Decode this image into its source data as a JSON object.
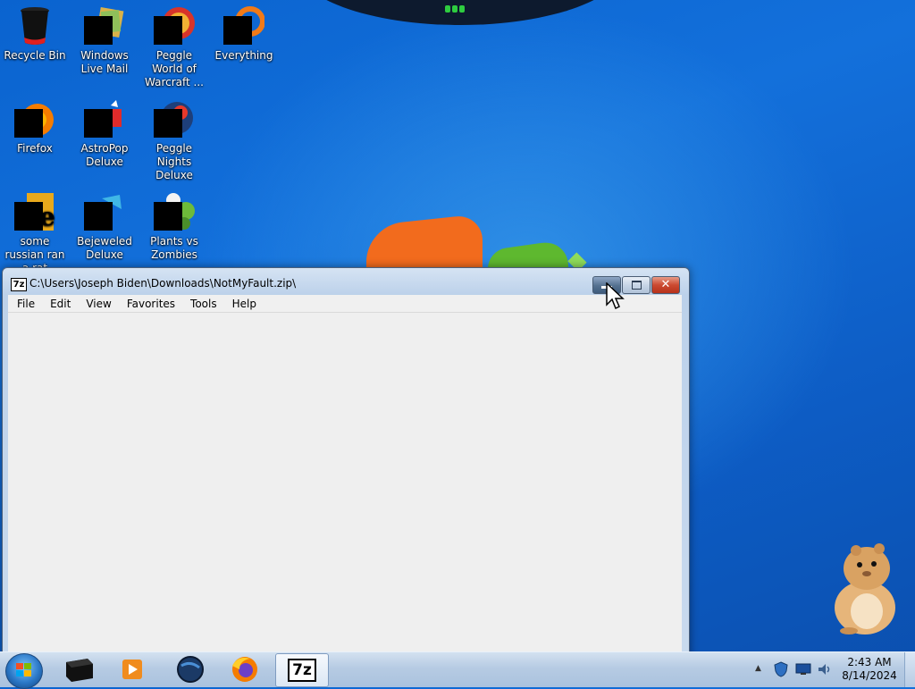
{
  "desktop": {
    "icons": [
      {
        "label": "Recycle Bin"
      },
      {
        "label": "Windows Live Mail"
      },
      {
        "label": "Peggle World of Warcraft ..."
      },
      {
        "label": "Everything"
      },
      {
        "label": "Firefox"
      },
      {
        "label": "AstroPop Deluxe"
      },
      {
        "label": "Peggle Nights Deluxe"
      },
      {
        "label": "some russian ran a rat"
      },
      {
        "label": "Bejeweled Deluxe"
      },
      {
        "label": "Plants vs Zombies"
      }
    ]
  },
  "window": {
    "title": "C:\\Users\\Joseph Biden\\Downloads\\NotMyFault.zip\\",
    "app_icon_text": "7z",
    "close_glyph": "✕",
    "menu": [
      "File",
      "Edit",
      "View",
      "Favorites",
      "Tools",
      "Help"
    ]
  },
  "taskbar": {
    "items": [
      {
        "icon": "black-box-icon"
      },
      {
        "icon": "media-player-icon"
      },
      {
        "icon": "globe-icon"
      },
      {
        "icon": "firefox-icon"
      },
      {
        "icon": "7zip-icon",
        "text": "7z",
        "active": true
      }
    ],
    "tray": [
      "show-hidden-icons-icon",
      "security-shield-icon",
      "monitor-icon",
      "volume-icon"
    ],
    "tray_arrow": "▲",
    "clock": {
      "time": "2:43 AM",
      "date": "8/14/2024"
    }
  },
  "colors": {
    "desktop_blue": "#1370db",
    "close_red": "#cb4a31",
    "window_frame": "#bcd1ea"
  }
}
